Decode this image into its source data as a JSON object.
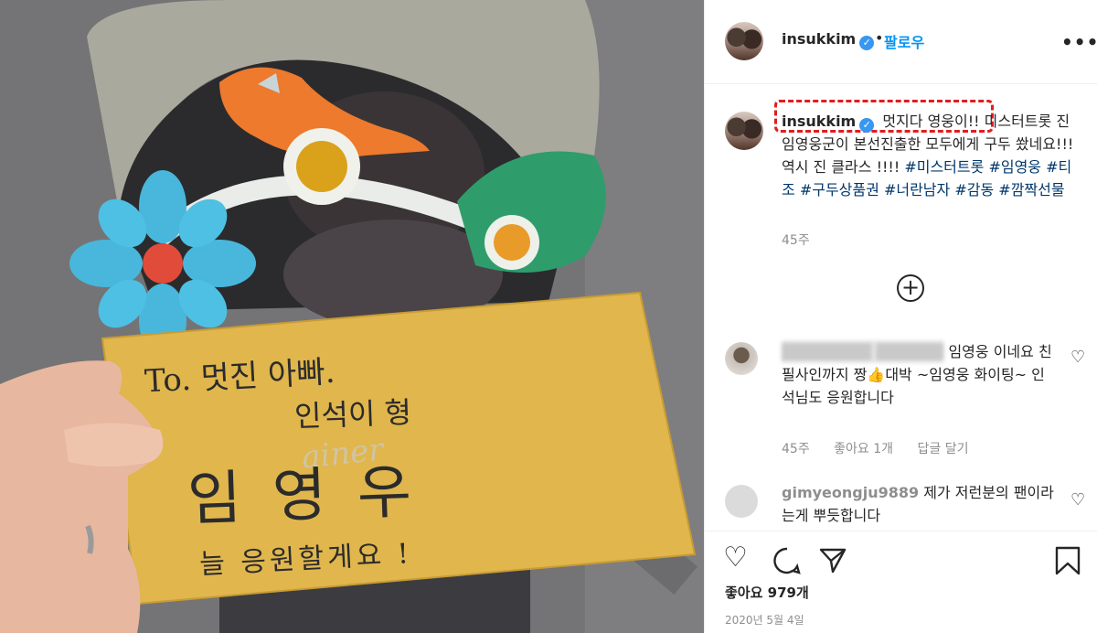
{
  "post": {
    "photo": {
      "envelope_lines": [
        "To. 멋진 아빠.",
        "인석이 형",
        "임영우",
        "늘 응원할게요 !"
      ],
      "watermark": "ainer"
    },
    "header": {
      "username": "insukkim",
      "verified_icon": "verified-badge-icon",
      "separator": "•",
      "follow_label": "팔로우",
      "more_label": "•••"
    },
    "caption": {
      "username": "insukkim",
      "text_highlighted": "멋지다 영웅이!!",
      "text": " 미스터트롯 진 임영웅군이 본선진출한 모두에게 구두 쐈네요!!! 역시 진 클라스 !!!! ",
      "hashtags": [
        "#미스터트롯",
        "#임영웅",
        "#티조",
        "#구두상품권",
        "#너란남자",
        "#감동",
        "#깜짝선물"
      ],
      "time": "45주"
    },
    "load_more_label": "+",
    "comments": [
      {
        "username_blurred": "",
        "text": "임영웅 이네요 친필사인까지 짱👍대박 ~임영웅 화이팅~ 인석님도 응원합니다",
        "time": "45주",
        "likes": "좋아요 1개",
        "reply": "답글 달기"
      },
      {
        "username": "gimyeongju9889",
        "text": "제가 저런분의 팬이라는게 뿌듯합니다"
      }
    ],
    "likes_label": "좋아요",
    "likes_count": "979개",
    "date": "2020년 5월 4일",
    "colors": {
      "link_blue": "#0095f6",
      "verified_blue": "#3897f0",
      "hashtag": "#00376b",
      "highlight_red": "#e01d1d"
    }
  }
}
